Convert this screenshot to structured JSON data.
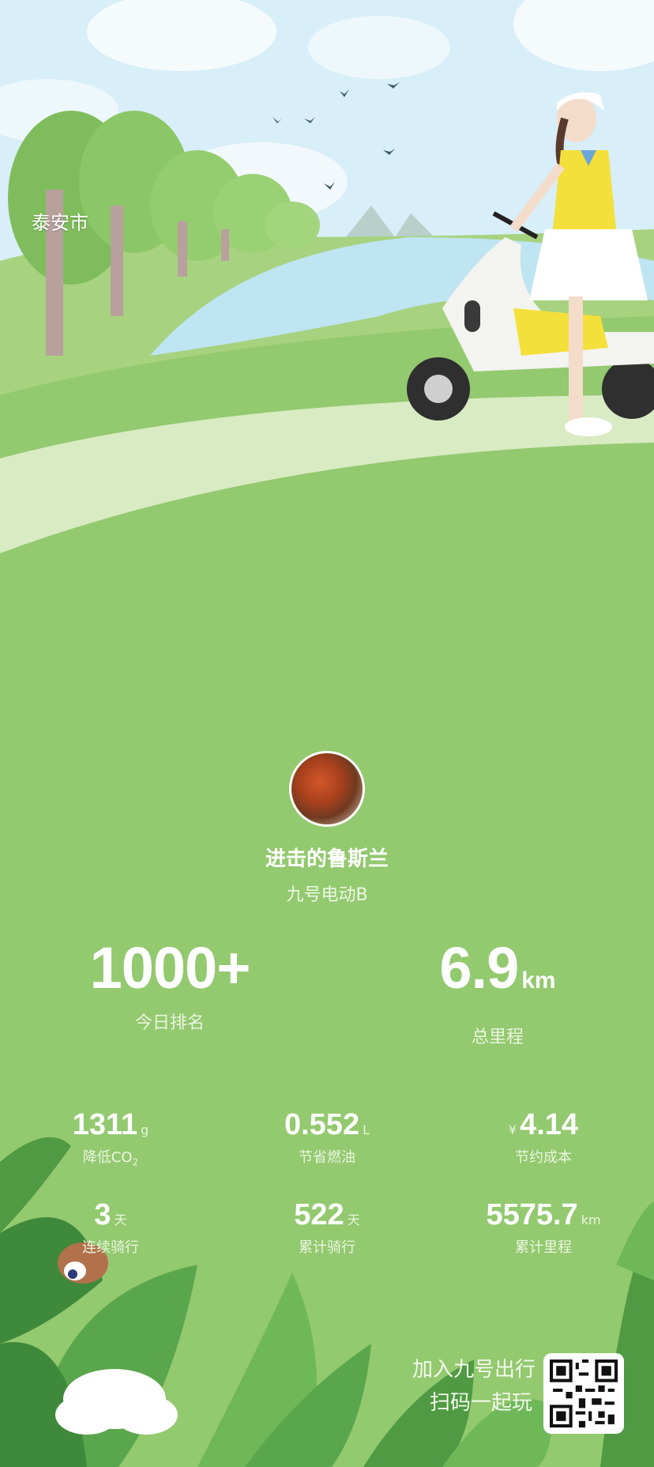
{
  "header": {
    "city": "泰安市"
  },
  "profile": {
    "username": "进击的鲁斯兰",
    "vehicle": "九号电动B"
  },
  "highlights": {
    "rank": {
      "value": "1000+",
      "label": "今日排名"
    },
    "distance": {
      "value": "6.9",
      "unit": "km",
      "label": "总里程"
    }
  },
  "stats": {
    "co2": {
      "value": "1311",
      "unit": "g",
      "label": "降低CO",
      "label_sub": "2"
    },
    "fuel": {
      "value": "0.552",
      "unit": "L",
      "label": "节省燃油"
    },
    "cost": {
      "prefix": "¥",
      "value": "4.14",
      "label": "节约成本"
    },
    "streak": {
      "value": "3",
      "unit": "天",
      "label": "连续骑行"
    },
    "days": {
      "value": "522",
      "unit": "天",
      "label": "累计骑行"
    },
    "total_distance": {
      "value": "5575.7",
      "unit": "km",
      "label": "累计里程"
    }
  },
  "promo": {
    "line1": "加入九号出行",
    "line2": "扫码一起玩"
  },
  "colors": {
    "grass": "#93c96f",
    "sky": "#d8eef8",
    "path": "#d9ebc3",
    "water": "#bfe4f2"
  }
}
